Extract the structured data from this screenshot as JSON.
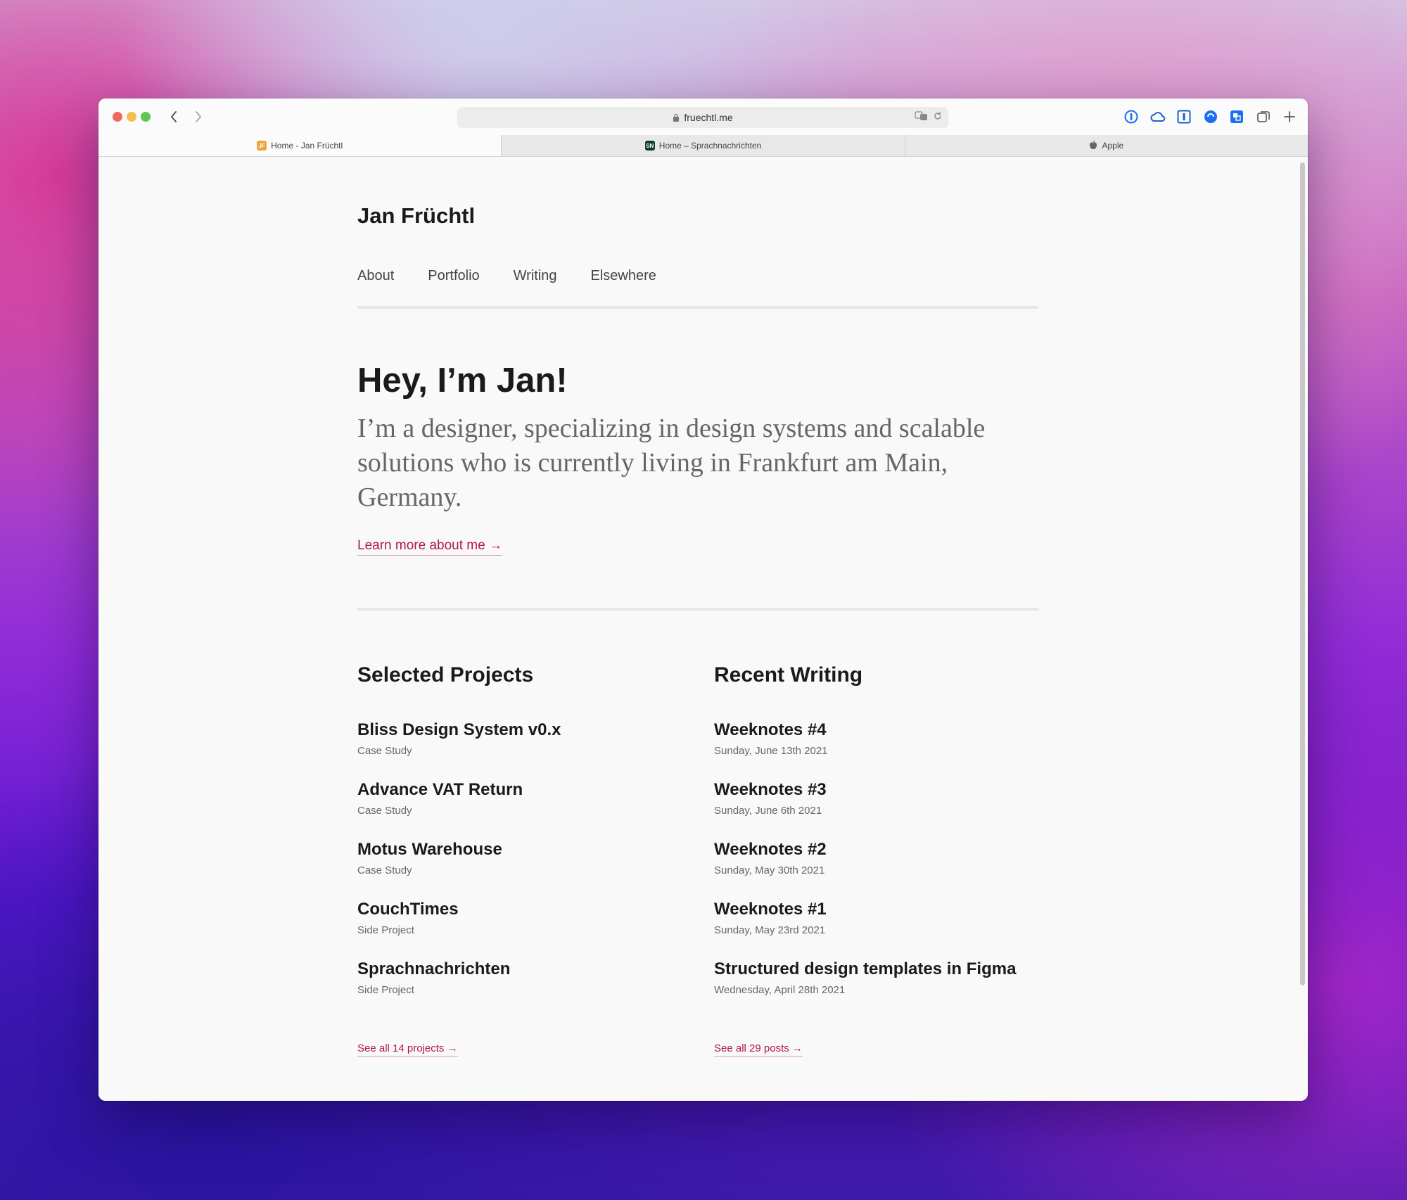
{
  "browser": {
    "url": "fruechtl.me",
    "tabs": [
      {
        "label": "Home - Jan Früchtl",
        "favicon": "JF",
        "active": true
      },
      {
        "label": "Home – Sprachnachrichten",
        "favicon": "SN",
        "active": false
      },
      {
        "label": "Apple",
        "favicon": "apple-icon",
        "active": false
      }
    ],
    "extensions": [
      "1password-icon",
      "cloud-icon",
      "instapaper-icon",
      "globe-icon",
      "translate-icon",
      "tabs-overview-icon",
      "new-tab-icon"
    ]
  },
  "site": {
    "title": "Jan Früchtl",
    "nav": [
      "About",
      "Portfolio",
      "Writing",
      "Elsewhere"
    ]
  },
  "hero": {
    "heading": "Hey, I’m Jan!",
    "intro": "I’m a designer, specializing in design systems and scalable solutions who is currently living in Frankfurt am Main, Germany.",
    "link": "Learn more about me →"
  },
  "projects": {
    "title": "Selected Projects",
    "items": [
      {
        "title": "Bliss Design System v0.x",
        "sub": "Case Study"
      },
      {
        "title": "Advance VAT Return",
        "sub": "Case Study"
      },
      {
        "title": "Motus Warehouse",
        "sub": "Case Study"
      },
      {
        "title": "CouchTimes",
        "sub": "Side Project"
      },
      {
        "title": "Sprachnachrichten",
        "sub": "Side Project"
      }
    ],
    "see_all": "See all 14 projects →"
  },
  "writing": {
    "title": "Recent Writing",
    "items": [
      {
        "title": "Weeknotes #4",
        "sub": "Sunday, June 13th 2021"
      },
      {
        "title": "Weeknotes #3",
        "sub": "Sunday, June 6th 2021"
      },
      {
        "title": "Weeknotes #2",
        "sub": "Sunday, May 30th 2021"
      },
      {
        "title": "Weeknotes #1",
        "sub": "Sunday, May 23rd 2021"
      },
      {
        "title": "Structured design templates in Figma",
        "sub": "Wednesday, April 28th 2021"
      }
    ],
    "see_all": "See all 29 posts →"
  },
  "colors": {
    "accent": "#b0164a",
    "text": "#1a1a1a",
    "muted": "#666666",
    "page_bg": "#faf9f9"
  }
}
